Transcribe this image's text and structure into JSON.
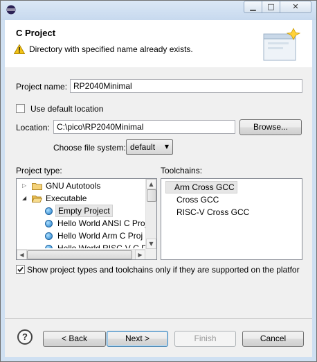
{
  "window": {
    "minimize_glyph": "▁",
    "maximize_glyph": "□",
    "close_glyph": "✕",
    "app_icon": "eclipse-icon"
  },
  "header": {
    "title": "C Project",
    "message": "Directory with specified name already exists.",
    "message_icon": "warning-icon"
  },
  "form": {
    "project_name_label": "Project name:",
    "project_name_value": "RP2040Minimal",
    "use_default_location_label": "Use default location",
    "use_default_location_checked": false,
    "location_label": "Location:",
    "location_value": "C:\\pico\\RP2040Minimal",
    "browse_label": "Browse...",
    "file_system_label": "Choose file system:",
    "file_system_value": "default"
  },
  "project_type": {
    "label": "Project type:",
    "items": [
      {
        "label": "GNU Autotools",
        "kind": "folder",
        "expanded": false
      },
      {
        "label": "Executable",
        "kind": "folder",
        "expanded": true
      },
      {
        "label": "Empty Project",
        "kind": "leaf",
        "selected": true
      },
      {
        "label": "Hello World ANSI C Proj",
        "kind": "leaf"
      },
      {
        "label": "Hello World Arm C Proj",
        "kind": "leaf"
      },
      {
        "label": "Hello World RISC-V C P",
        "kind": "leaf"
      }
    ]
  },
  "toolchains": {
    "label": "Toolchains:",
    "items": [
      "Arm Cross GCC",
      "Cross GCC",
      "RISC-V Cross GCC"
    ],
    "selected_index": 0
  },
  "filter": {
    "label": "Show project types and toolchains only if they are supported on the platfor",
    "checked": true
  },
  "buttons": {
    "help": "?",
    "back": "< Back",
    "next": "Next >",
    "finish": "Finish",
    "cancel": "Cancel"
  },
  "colors": {
    "accent": "#1f7ecb",
    "warning": "#f2c318"
  }
}
